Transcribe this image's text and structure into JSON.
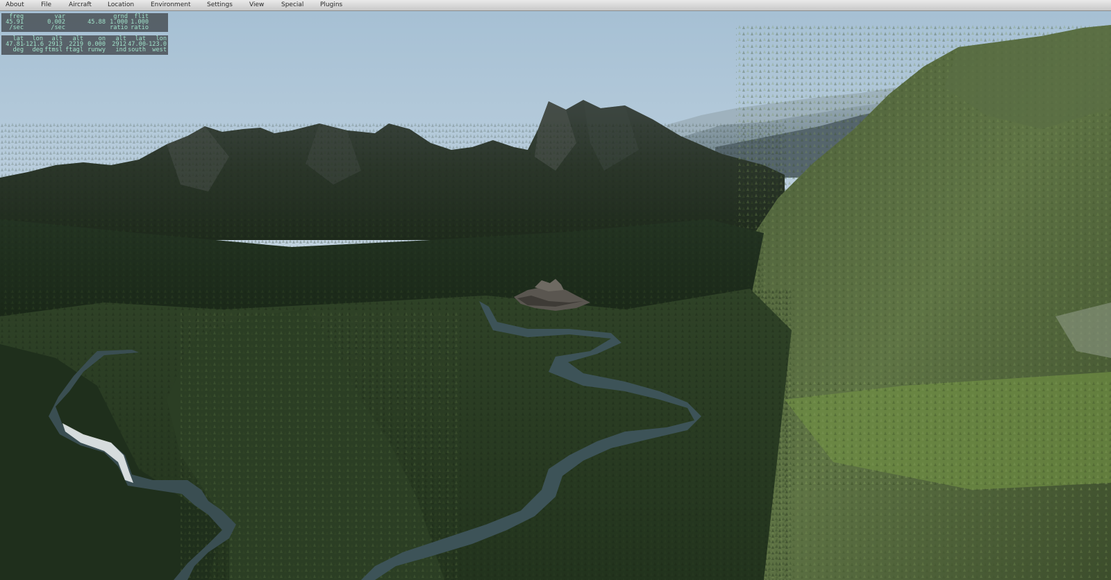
{
  "menu": {
    "items": [
      {
        "label": "About"
      },
      {
        "label": "File"
      },
      {
        "label": "Aircraft"
      },
      {
        "label": "Location"
      },
      {
        "label": "Environment"
      },
      {
        "label": "Settings"
      },
      {
        "label": "View"
      },
      {
        "label": "Special"
      },
      {
        "label": "Plugins"
      }
    ]
  },
  "data_output": {
    "frame_rate": {
      "row_top": [
        "freq",
        "var",
        "grnd",
        "flit"
      ],
      "row_values": [
        "45.91",
        "0.002",
        "45.88",
        "1.000",
        "1.000"
      ],
      "row_units": [
        "/sec",
        "/sec",
        "ratio",
        "ratio"
      ]
    },
    "position": {
      "row_top": [
        "lat",
        "lon",
        "alt",
        "alt",
        "on",
        "alt",
        "lat",
        "lon"
      ],
      "row_values": [
        "47.81",
        "-121.6",
        "2913",
        "2219",
        "0.000",
        "2912",
        "47.00",
        "-123.0"
      ],
      "row_units": [
        "deg",
        "deg",
        "ftmsl",
        "ftagl",
        "runwy",
        "ind",
        "south",
        "west"
      ]
    }
  },
  "colors": {
    "sky_top": "#a9c3d6",
    "sky_horizon": "#dfe8ec",
    "forest_dark": "#1f2c1d",
    "forest_mid": "#3a4f2c",
    "forest_light": "#6f8c4a",
    "river": "#3d5358",
    "panel_text": "#9fe0c8"
  }
}
